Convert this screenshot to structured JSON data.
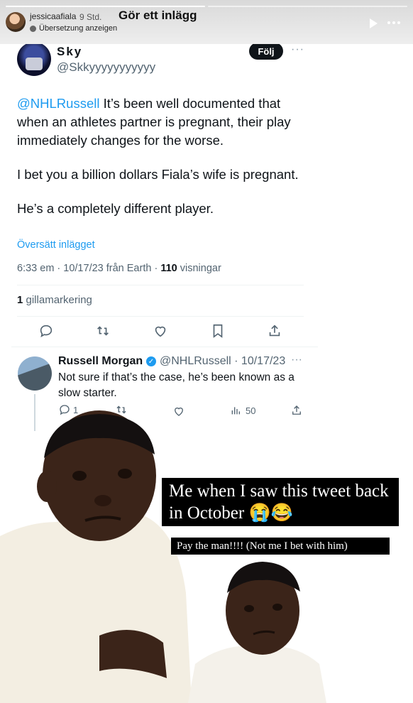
{
  "story": {
    "username": "jessicaafiala",
    "time": "9 Std.",
    "translate_label": "Übersetzung anzeigen",
    "caption": "Gör ett inlägg",
    "progress_segments": 2,
    "progress_done": 1
  },
  "tweet": {
    "display_name": "Sky",
    "handle": "@Skkyyyyyyyyyyy",
    "follow_label": "Följ",
    "body": {
      "mention": "@NHLRussell",
      "line1_rest": " It’s been well documented that when an athletes partner is pregnant, their play immediately changes for the worse.",
      "paragraph2": "I bet you a billion dollars Fiala’s wife is pregnant.",
      "paragraph3": "He’s a completely different player."
    },
    "translate_link": "Översätt inlägget",
    "meta_prefix": "6:33 em · 10/17/23 från Earth · ",
    "views_count": "110",
    "views_label": " visningar",
    "likes_count": "1",
    "likes_label": " gillamarkering"
  },
  "reply": {
    "display_name": "Russell Morgan",
    "handle_date": "@NHLRussell · 10/17/23",
    "body": "Not sure if that’s the case, he’s been known as a slow starter.",
    "reply_count": "1",
    "views_count": "50"
  },
  "meme": {
    "caption_main": "Me when I saw this tweet back in October 😭😂",
    "caption_sub": "Pay the man!!!! (Not me I bet with him)"
  },
  "colors": {
    "link": "#1d9bf0",
    "text": "#0f1419",
    "muted": "#536471"
  }
}
